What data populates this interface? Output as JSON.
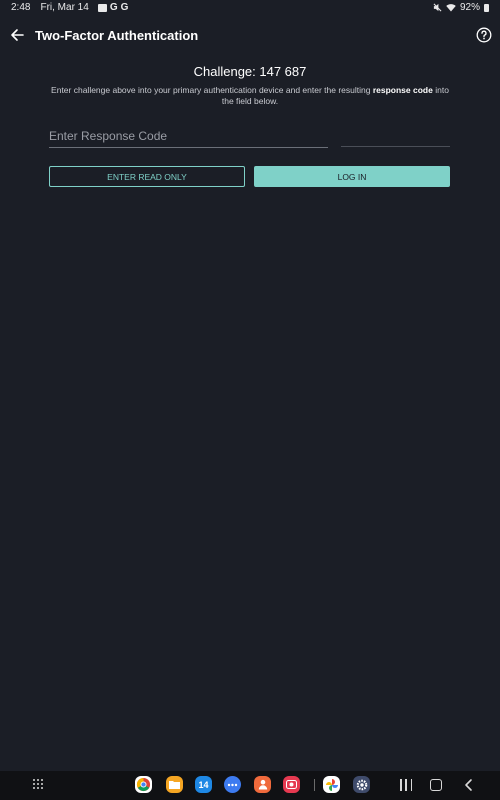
{
  "status_bar": {
    "time": "2:48",
    "date": "Fri, Mar 14",
    "notification_icons": [
      "photo-icon",
      "google-icon",
      "google-icon"
    ],
    "notification_g": "G",
    "battery": "92%",
    "right_icons": [
      "mute-icon",
      "wifi-icon",
      "battery-icon"
    ]
  },
  "app_bar": {
    "title": "Two-Factor Authentication",
    "back_icon": "arrow-left-icon",
    "help_icon": "question-circle-icon"
  },
  "challenge": {
    "label": "Challenge: 147 687",
    "instructions_pre": "Enter challenge above into your primary authentication device and enter the resulting",
    "instructions_bold1": "response",
    "instructions_bold2": "code",
    "instructions_post": "into the field below."
  },
  "form": {
    "response_placeholder": "Enter Response Code",
    "response_value": ""
  },
  "buttons": {
    "read_only_label": "ENTER READ ONLY",
    "login_label": "LOG IN"
  },
  "colors": {
    "background": "#1b1e26",
    "accent": "#7fd1c8",
    "nav_background": "#101114"
  },
  "nav_bar": {
    "apps": [
      {
        "name": "chrome-icon"
      },
      {
        "name": "files-icon"
      },
      {
        "name": "calendar-icon"
      },
      {
        "name": "messages-icon"
      },
      {
        "name": "contacts-icon"
      },
      {
        "name": "screen-recorder-icon"
      },
      {
        "name": "photos-icon"
      },
      {
        "name": "settings-icon"
      }
    ],
    "calendar_day": "14",
    "buttons": [
      "app-drawer-icon",
      "recents-icon",
      "home-icon",
      "nav-back-icon"
    ]
  }
}
